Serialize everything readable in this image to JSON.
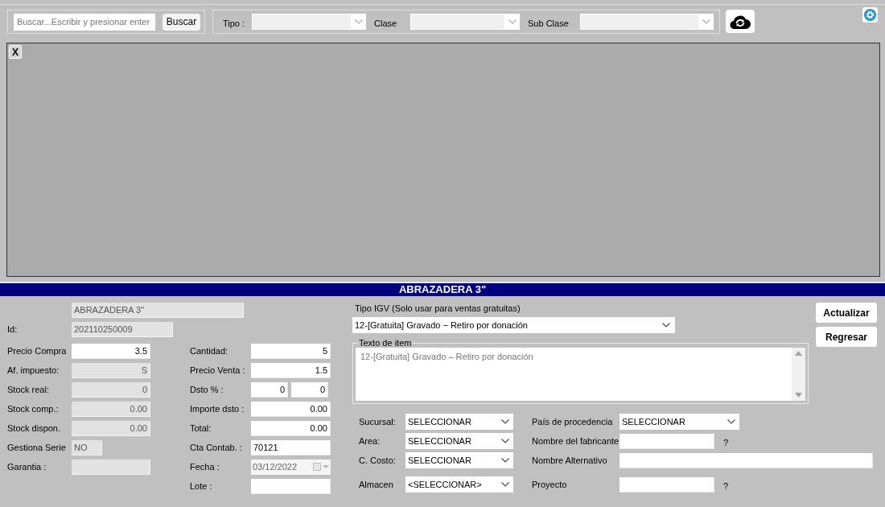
{
  "search": {
    "placeholder": "Buscar...Escribir y presionar enter",
    "button": "Buscar"
  },
  "filters": [
    {
      "label": "Tipo :"
    },
    {
      "label": "Clase"
    },
    {
      "label": "Sub Clase"
    }
  ],
  "grid": {
    "close": "X"
  },
  "title": "ABRAZADERA 3\"",
  "name_field": {
    "value": "ABRAZADERA 3\"",
    "disabled": true
  },
  "id_field": {
    "label": "Id:",
    "value": "202110250009",
    "disabled": true
  },
  "fields_a": [
    {
      "label": "Precio Compra",
      "kind": "number",
      "value": "3.5",
      "disabled": false
    },
    {
      "label": "Af. impuesto:",
      "kind": "number",
      "value": "S",
      "disabled": true
    },
    {
      "label": "Stock real:",
      "kind": "number",
      "value": "0",
      "disabled": true
    },
    {
      "label": "Stock comp.:",
      "kind": "number",
      "value": "0.00",
      "disabled": true
    },
    {
      "label": "Stock dispon.",
      "kind": "number",
      "value": "0.00",
      "disabled": true
    },
    {
      "label": "Gestiona Serie",
      "kind": "short",
      "value": "NO",
      "disabled": true
    },
    {
      "label": "Garantia :",
      "kind": "text",
      "disabled": true
    }
  ],
  "fields_b": [
    {
      "label": "Cantidad:",
      "kind": "number",
      "value": "5",
      "disabled": false
    },
    {
      "label": "Precio Venta :",
      "kind": "number",
      "value": "1.5",
      "disabled": false
    },
    {
      "label": "Dsto % :",
      "kind": "pair",
      "values": [
        "0",
        "0"
      ],
      "disabled": false
    },
    {
      "label": "Importe dsto :",
      "kind": "number",
      "value": "0.00",
      "disabled": false
    },
    {
      "label": "Total:",
      "kind": "number",
      "value": "0.00",
      "disabled": false
    },
    {
      "label": "Cta Contab. :",
      "kind": "text",
      "value": "70121",
      "disabled": false
    },
    {
      "label": "Fecha :",
      "kind": "date",
      "value": "03/12/2022",
      "disabled": true
    },
    {
      "label": "Lote :",
      "kind": "text",
      "disabled": false
    }
  ],
  "igv": {
    "label": "Tipo IGV (Solo usar para ventas gratuitas)",
    "value": "12-[Gratuita] Gravado − Retiro por donación"
  },
  "item_text": {
    "legend": "Texto de item",
    "value": "12-[Gratuita] Gravado – Retiro por donación"
  },
  "buttons": [
    "Actualizar",
    "Regresar"
  ],
  "selects": [
    {
      "label": "Sucursal:",
      "value": "SELECCIONAR"
    },
    {
      "label": "Area:",
      "value": "SELECCIONAR"
    },
    {
      "label": "C. Costo:",
      "value": "SELECCIONAR"
    },
    {
      "label": "Almacen",
      "value": "<SELECCIONAR>"
    }
  ],
  "fields_c": [
    {
      "label": "País de procedencia",
      "kind": "select",
      "value": "SELECCIONAR"
    },
    {
      "label": "Nombre del fabricante",
      "kind": "input",
      "help": "?"
    },
    {
      "label": "Nombre Alternativo",
      "kind": "wide"
    },
    {
      "label": "Proyecto",
      "kind": "input",
      "help": "?"
    }
  ]
}
